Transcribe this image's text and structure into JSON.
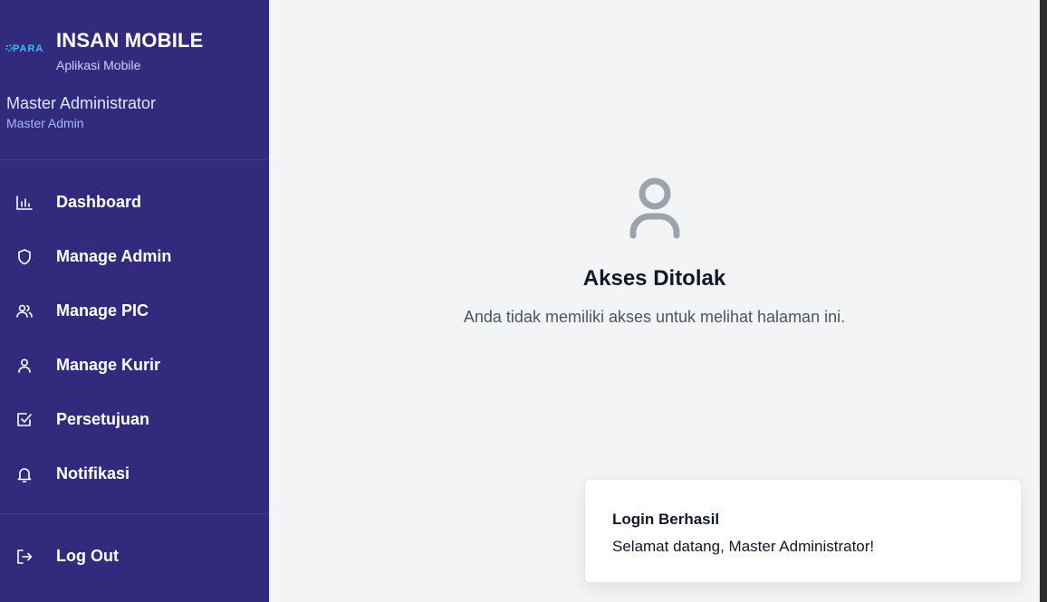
{
  "app": {
    "logo_text": "PARA",
    "title": "INSAN MOBILE",
    "subtitle": "Aplikasi Mobile"
  },
  "user": {
    "name": "Master Administrator",
    "role": "Master Admin"
  },
  "nav": {
    "items": [
      {
        "label": "Dashboard",
        "icon": "bar-chart-icon"
      },
      {
        "label": "Manage Admin",
        "icon": "shield-icon"
      },
      {
        "label": "Manage PIC",
        "icon": "users-icon"
      },
      {
        "label": "Manage Kurir",
        "icon": "user-icon"
      },
      {
        "label": "Persetujuan",
        "icon": "checkbox-icon"
      },
      {
        "label": "Notifikasi",
        "icon": "bell-icon"
      }
    ],
    "logout_label": "Log Out",
    "logout_icon": "logout-icon"
  },
  "main": {
    "title": "Akses Ditolak",
    "message": "Anda tidak memiliki akses untuk melihat halaman ini.",
    "icon": "user-icon"
  },
  "toast": {
    "title": "Login Berhasil",
    "message": "Selamat datang, Master Administrator!"
  },
  "colors": {
    "sidebar_bg": "#322b7d",
    "main_bg": "#f3f4f6",
    "accent_text": "#a5b4fc"
  }
}
